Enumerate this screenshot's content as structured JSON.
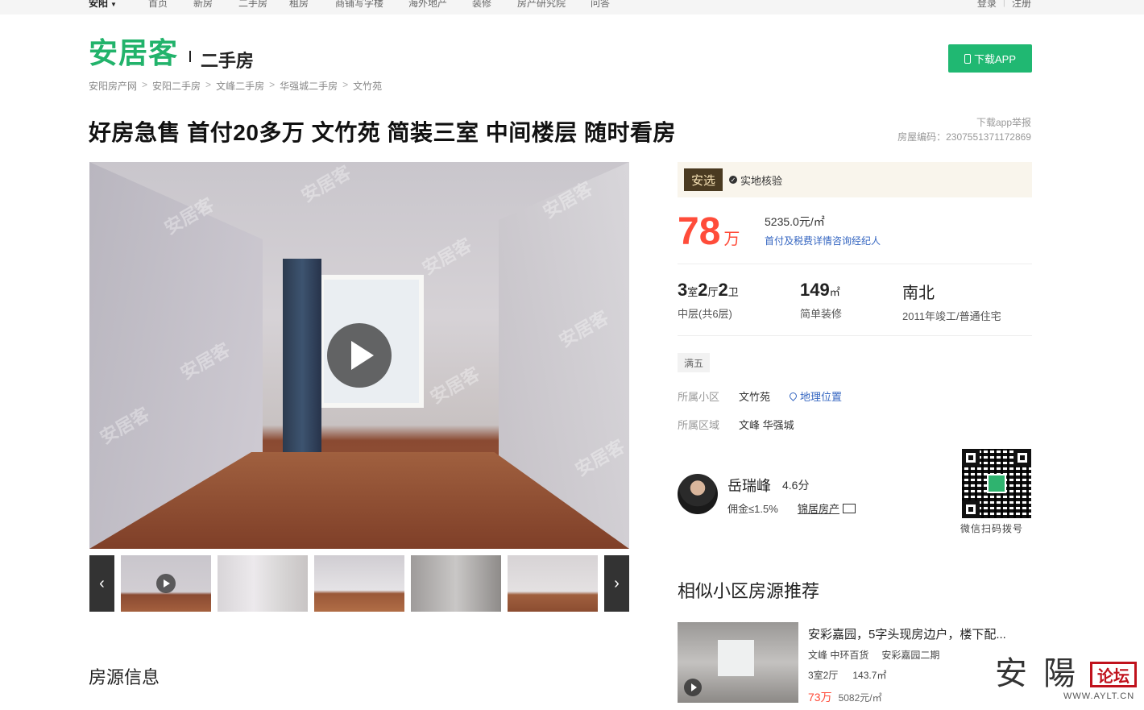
{
  "topnav": {
    "city": "安阳",
    "links": [
      "首页",
      "新房",
      "二手房",
      "租房",
      "商铺写字楼",
      "海外地产",
      "装修",
      "房产研究院",
      "问答"
    ],
    "login": "登录",
    "register": "注册"
  },
  "header": {
    "logo": "安居客",
    "channel": "二手房",
    "download_button": "下载APP"
  },
  "breadcrumb": [
    "安阳房产网",
    "安阳二手房",
    "文峰二手房",
    "华强城二手房",
    "文竹苑"
  ],
  "listing": {
    "title": "好房急售 首付20多万 文竹苑 简装三室 中间楼层 随时看房",
    "report": "下载app举报",
    "house_code": "房屋编码：2307551371172869"
  },
  "gallery": {
    "watermark": "安居客",
    "prev_label": "‹",
    "next_label": "›"
  },
  "summary": {
    "badge": "安选",
    "verify": "实地核验",
    "price": "78",
    "price_unit": "万",
    "unit_price": "5235.0元/㎡",
    "pay_link": "首付及税费详情咨询经纪人",
    "rooms": {
      "shi": "3",
      "shi_u": "室",
      "ting": "2",
      "ting_u": "厅",
      "wei": "2",
      "wei_u": "卫",
      "floor": "中层(共6层)"
    },
    "area": {
      "value": "149",
      "unit": "㎡",
      "decoration": "简单装修"
    },
    "orientation": {
      "value": "南北",
      "detail": "2011年竣工/普通住宅"
    },
    "tag": "满五",
    "community_label": "所属小区",
    "community_value": "文竹苑",
    "location_link": "地理位置",
    "region_label": "所属区域",
    "region_value": "文峰 华强城"
  },
  "agent": {
    "name": "岳瑞峰",
    "score": "4.6分",
    "commission": "佣金≤1.5%",
    "company": "锦居房产",
    "qr_label": "微信扫码拨号"
  },
  "similar": {
    "title": "相似小区房源推荐",
    "item": {
      "name": "安彩嘉园，5字头现房边户，楼下配...",
      "district": "文峰 中环百货",
      "community": "安彩嘉园二期",
      "layout": "3室2厅",
      "area": "143.7㎡",
      "price": "73万",
      "unit_price": "5082元/㎡"
    }
  },
  "sections": {
    "house_info": "房源信息"
  },
  "forum_watermark": {
    "chars": "安陽",
    "box": "论坛",
    "site": "WWW.AYLT.CN"
  },
  "colors": {
    "brand_green": "#20b872",
    "price_red": "#ff4c3a",
    "link_blue": "#3566c1"
  }
}
